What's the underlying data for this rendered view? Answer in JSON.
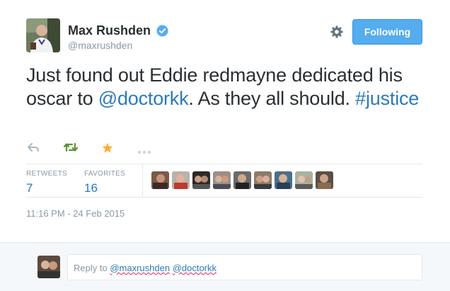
{
  "author": {
    "name": "Max Rushden",
    "handle": "@maxrushden",
    "verified": true
  },
  "follow_button": {
    "label": "Following"
  },
  "tweet": {
    "text_before": "Just found out Eddie redmayne dedicated his oscar to ",
    "mention": "@doctorkk",
    "text_after": ". As they all should. ",
    "hashtag": "#justice"
  },
  "actions": {
    "icons": [
      "reply-icon",
      "retweet-icon",
      "favorite-icon",
      "more-icon"
    ]
  },
  "stats": {
    "retweets_label": "RETWEETS",
    "retweets_value": "7",
    "favorites_label": "FAVORITES",
    "favorites_value": "16"
  },
  "timestamp": "11:16 PM - 24 Feb 2015",
  "reply": {
    "prefix": "Reply to ",
    "mention1": "@maxrushden",
    "mention2": "@doctorkk"
  },
  "colors": {
    "link": "#2b7bb9",
    "button": "#55acee",
    "retweet": "#5c913b",
    "favorite": "#ffac33",
    "muted": "#8899a6"
  }
}
